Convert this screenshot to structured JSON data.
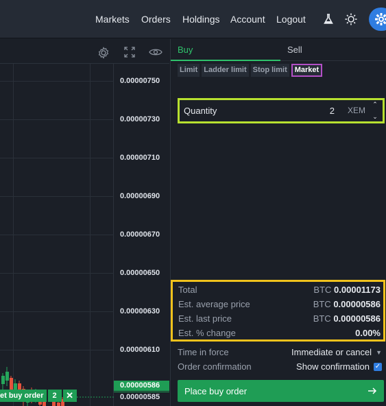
{
  "nav": {
    "markets": "Markets",
    "orders": "Orders",
    "holdings": "Holdings",
    "account": "Account",
    "logout": "Logout"
  },
  "chart": {
    "ticks": [
      "0.00000750",
      "0.00000730",
      "0.00000710",
      "0.00000690",
      "0.00000670",
      "0.00000650",
      "0.00000630",
      "0.00000610"
    ],
    "price_tags": [
      "0.00000586",
      "0.00000585"
    ],
    "order_label": "et buy order",
    "order_qty": "2",
    "order_close": "✕"
  },
  "panel": {
    "tab_buy": "Buy",
    "tab_sell": "Sell",
    "order_types": [
      "Limit",
      "Ladder limit",
      "Stop limit",
      "Market"
    ],
    "quantity_label": "Quantity",
    "quantity_value": "2",
    "quantity_unit": "XEM",
    "summary": [
      {
        "label": "Total",
        "currency": "BTC",
        "value": "0.00001173"
      },
      {
        "label": "Est. average price",
        "currency": "BTC",
        "value": "0.00000586"
      },
      {
        "label": "Est. last price",
        "currency": "BTC",
        "value": "0.00000586"
      },
      {
        "label": "Est. % change",
        "currency": "",
        "value": "0.00%"
      }
    ],
    "time_in_force_label": "Time in force",
    "time_in_force_value": "Immediate or cancel",
    "order_confirmation_label": "Order confirmation",
    "order_confirmation_value": "Show confirmation",
    "place_order": "Place buy order"
  },
  "colors": {
    "buy_green": "#1f9d55",
    "accent_blue": "#2f7de1",
    "highlight_quantity": "#b7e02f",
    "highlight_summary": "#f0c21c",
    "highlight_market": "#b34fc6"
  }
}
